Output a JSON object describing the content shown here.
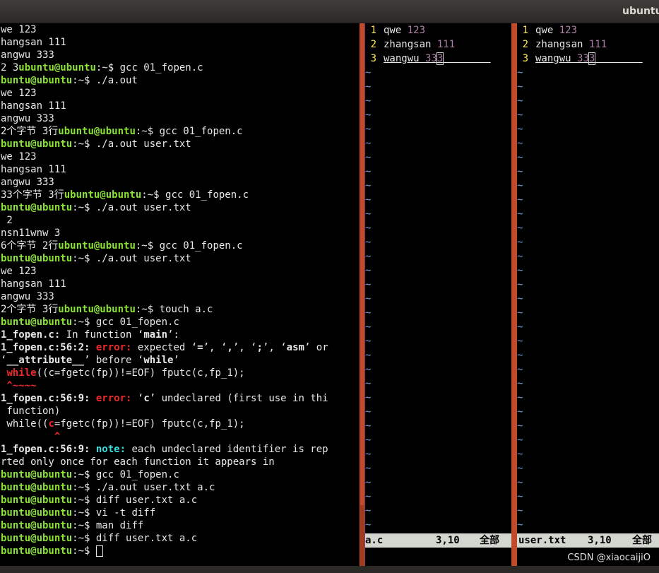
{
  "window": {
    "title": "ubuntu"
  },
  "terminal": {
    "lines": [
      [
        [
          "we 123",
          ""
        ]
      ],
      [
        [
          "hangsan 111",
          ""
        ]
      ],
      [
        [
          "angwu 333",
          ""
        ]
      ],
      [
        [
          "2 3",
          ""
        ],
        [
          "ubuntu@ubuntu",
          "green"
        ],
        [
          ":~$ gcc 01_fopen.c",
          ""
        ]
      ],
      [
        [
          "buntu@ubuntu",
          "green"
        ],
        [
          ":~$ ./a.out",
          ""
        ]
      ],
      [
        [
          "we 123",
          ""
        ]
      ],
      [
        [
          "hangsan 111",
          ""
        ]
      ],
      [
        [
          "angwu 333",
          ""
        ]
      ],
      [
        [
          "2个字节 3行",
          ""
        ],
        [
          "ubuntu@ubuntu",
          "green"
        ],
        [
          ":~$ gcc 01_fopen.c",
          ""
        ]
      ],
      [
        [
          "buntu@ubuntu",
          "green"
        ],
        [
          ":~$ ./a.out user.txt",
          ""
        ]
      ],
      [
        [
          "we 123",
          ""
        ]
      ],
      [
        [
          "hangsan 111",
          ""
        ]
      ],
      [
        [
          "angwu 333",
          ""
        ]
      ],
      [
        [
          "33个字节 3行",
          ""
        ],
        [
          "ubuntu@ubuntu",
          "green"
        ],
        [
          ":~$ gcc 01_fopen.c",
          ""
        ]
      ],
      [
        [
          "buntu@ubuntu",
          "green"
        ],
        [
          ":~$ ./a.out user.txt",
          ""
        ]
      ],
      [
        [
          " 2",
          ""
        ]
      ],
      [
        [
          "nsn11wnw 3",
          ""
        ]
      ],
      [
        [
          "6个字节 2行",
          ""
        ],
        [
          "ubuntu@ubuntu",
          "green"
        ],
        [
          ":~$ gcc 01_fopen.c",
          ""
        ]
      ],
      [
        [
          "buntu@ubuntu",
          "green"
        ],
        [
          ":~$ ./a.out user.txt",
          ""
        ]
      ],
      [
        [
          "we 123",
          ""
        ]
      ],
      [
        [
          "hangsan 111",
          ""
        ]
      ],
      [
        [
          "angwu 333",
          ""
        ]
      ],
      [
        [
          "2个字节 3行",
          ""
        ],
        [
          "ubuntu@ubuntu",
          "green"
        ],
        [
          ":~$ touch a.c",
          ""
        ]
      ],
      [
        [
          "buntu@ubuntu",
          "green"
        ],
        [
          ":~$ gcc 01_fopen.c",
          ""
        ]
      ],
      [
        [
          "1_fopen.c:",
          "bold"
        ],
        [
          " In function ‘",
          ""
        ],
        [
          "main",
          "bold"
        ],
        [
          "’:",
          ""
        ]
      ],
      [
        [
          "1_fopen.c:56:2: ",
          "bold"
        ],
        [
          "error: ",
          "err"
        ],
        [
          "expected ‘",
          ""
        ],
        [
          "=",
          "bold"
        ],
        [
          "’, ‘",
          ""
        ],
        [
          ",",
          "bold"
        ],
        [
          "’, ‘",
          ""
        ],
        [
          ";",
          "bold"
        ],
        [
          "’, ‘",
          ""
        ],
        [
          "asm",
          "bold"
        ],
        [
          "’ or",
          ""
        ]
      ],
      [
        [
          "‘",
          ""
        ],
        [
          "__attribute__",
          "bold"
        ],
        [
          "’ before ‘",
          ""
        ],
        [
          "while",
          "bold"
        ],
        [
          "’",
          ""
        ]
      ],
      [
        [
          " ",
          ""
        ],
        [
          "while",
          "err"
        ],
        [
          "((c=fgetc(fp))!=EOF) fputc(c,fp_1);",
          ""
        ]
      ],
      [
        [
          " ^~~~~",
          "err"
        ]
      ],
      [
        [
          "1_fopen.c:56:9: ",
          "bold"
        ],
        [
          "error: ",
          "err"
        ],
        [
          "‘",
          ""
        ],
        [
          "c",
          "bold"
        ],
        [
          "’ undeclared (first use in thi",
          ""
        ]
      ],
      [
        [
          " function)",
          ""
        ]
      ],
      [
        [
          " while((",
          ""
        ],
        [
          "c",
          "err"
        ],
        [
          "=fgetc(fp))!=EOF) fputc(c,fp_1);",
          ""
        ]
      ],
      [
        [
          "         ^",
          "err"
        ]
      ],
      [
        [
          "1_fopen.c:56:9: ",
          "bold"
        ],
        [
          "note: ",
          "note"
        ],
        [
          "each undeclared identifier is rep",
          ""
        ]
      ],
      [
        [
          "rted only once for each function it appears in",
          ""
        ]
      ],
      [
        [
          "buntu@ubuntu",
          "green"
        ],
        [
          ":~$ gcc 01_fopen.c",
          ""
        ]
      ],
      [
        [
          "buntu@ubuntu",
          "green"
        ],
        [
          ":~$ ./a.out user.txt a.c",
          ""
        ]
      ],
      [
        [
          "buntu@ubuntu",
          "green"
        ],
        [
          ":~$ diff user.txt a.c",
          ""
        ]
      ],
      [
        [
          "buntu@ubuntu",
          "green"
        ],
        [
          ":~$ vi -t diff",
          ""
        ]
      ],
      [
        [
          "buntu@ubuntu",
          "green"
        ],
        [
          ":~$ man diff",
          ""
        ]
      ],
      [
        [
          "buntu@ubuntu",
          "green"
        ],
        [
          ":~$ diff user.txt a.c",
          ""
        ]
      ],
      [
        [
          "buntu@ubuntu",
          "green"
        ],
        [
          ":~$ ",
          ""
        ]
      ]
    ]
  },
  "vim_left": {
    "lines": [
      {
        "num": "1",
        "text": "qwe",
        "value": "123"
      },
      {
        "num": "2",
        "text": "zhangsan",
        "value": "111"
      },
      {
        "num": "3",
        "text": "wangwu",
        "value": "333"
      }
    ],
    "tildes": 33,
    "status": {
      "file": "a.c",
      "pos": "3,10",
      "scope": "全部"
    }
  },
  "vim_right": {
    "lines": [
      {
        "num": "1",
        "text": "qwe",
        "value": "123"
      },
      {
        "num": "2",
        "text": "zhangsan",
        "value": "111"
      },
      {
        "num": "3",
        "text": "wangwu",
        "value": "333"
      }
    ],
    "tildes": 33,
    "status": {
      "file": "user.txt",
      "pos": "3,10",
      "scope": "全部"
    }
  },
  "watermark": "CSDN @xiaocaijiO",
  "colors": {
    "prompt": "#8ae234",
    "error": "#ef2929",
    "note": "#34e2e2",
    "divider": "#c04a2a"
  }
}
